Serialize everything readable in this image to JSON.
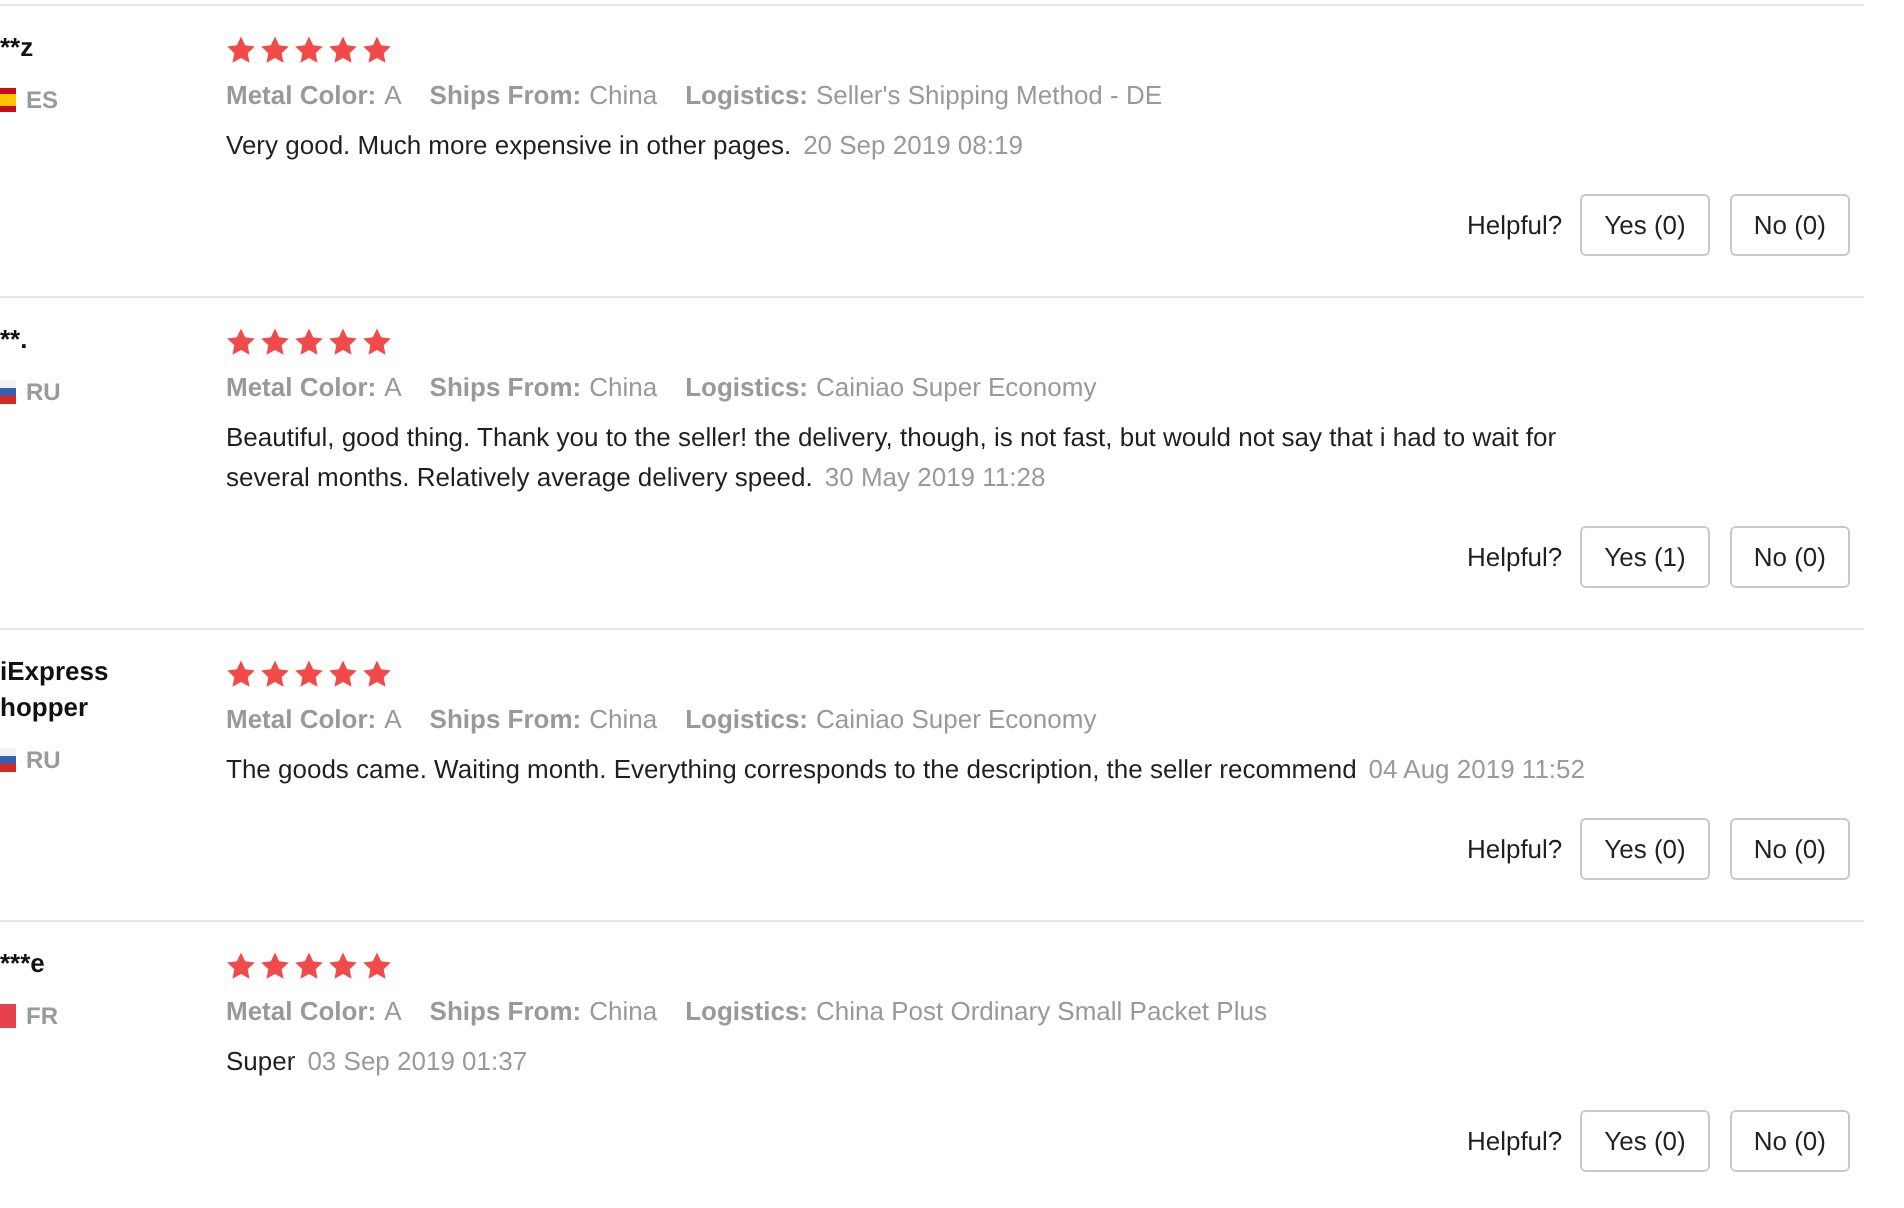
{
  "reviews": [
    {
      "reviewer": {
        "name": "**z",
        "flag": {
          "kind": "spain"
        },
        "country": "ES"
      },
      "stars": 5,
      "attributes": [
        {
          "label": "Metal Color:",
          "value": "A"
        },
        {
          "label": "Ships From:",
          "value": "China"
        },
        {
          "label": "Logistics:",
          "value": "Seller's Shipping Method - DE"
        }
      ],
      "text": "Very good. Much more expensive in other pages.",
      "date": "20 Sep 2019 08:19",
      "helpful": {
        "label": "Helpful?",
        "yes": "Yes (0)",
        "no": "No (0)"
      }
    },
    {
      "reviewer": {
        "name": "**.",
        "flag": {
          "kind": "russia"
        },
        "country": "RU"
      },
      "stars": 5,
      "attributes": [
        {
          "label": "Metal Color:",
          "value": "A"
        },
        {
          "label": "Ships From:",
          "value": "China"
        },
        {
          "label": "Logistics:",
          "value": "Cainiao Super Economy"
        }
      ],
      "text": "Beautiful, good thing. Thank you to the seller! the delivery, though, is not fast, but would not say that i had to wait for several months. Relatively average delivery speed.",
      "date": "30 May 2019 11:28",
      "helpful": {
        "label": "Helpful?",
        "yes": "Yes (1)",
        "no": "No (0)"
      }
    },
    {
      "reviewer": {
        "name": "iExpress hopper",
        "flag": {
          "kind": "russia"
        },
        "country": "RU"
      },
      "stars": 5,
      "attributes": [
        {
          "label": "Metal Color:",
          "value": "A"
        },
        {
          "label": "Ships From:",
          "value": "China"
        },
        {
          "label": "Logistics:",
          "value": "Cainiao Super Economy"
        }
      ],
      "text": "The goods came. Waiting month. Everything corresponds to the description, the seller recommend",
      "date": "04 Aug 2019 11:52",
      "helpful": {
        "label": "Helpful?",
        "yes": "Yes (0)",
        "no": "No (0)"
      }
    },
    {
      "reviewer": {
        "name": "***e",
        "flag": {
          "kind": "france"
        },
        "country": "FR"
      },
      "stars": 5,
      "attributes": [
        {
          "label": "Metal Color:",
          "value": "A"
        },
        {
          "label": "Ships From:",
          "value": "China"
        },
        {
          "label": "Logistics:",
          "value": "China Post Ordinary Small Packet Plus"
        }
      ],
      "text": "Super",
      "date": "03 Sep 2019 01:37",
      "helpful": {
        "label": "Helpful?",
        "yes": "Yes (0)",
        "no": "No (0)"
      }
    }
  ]
}
